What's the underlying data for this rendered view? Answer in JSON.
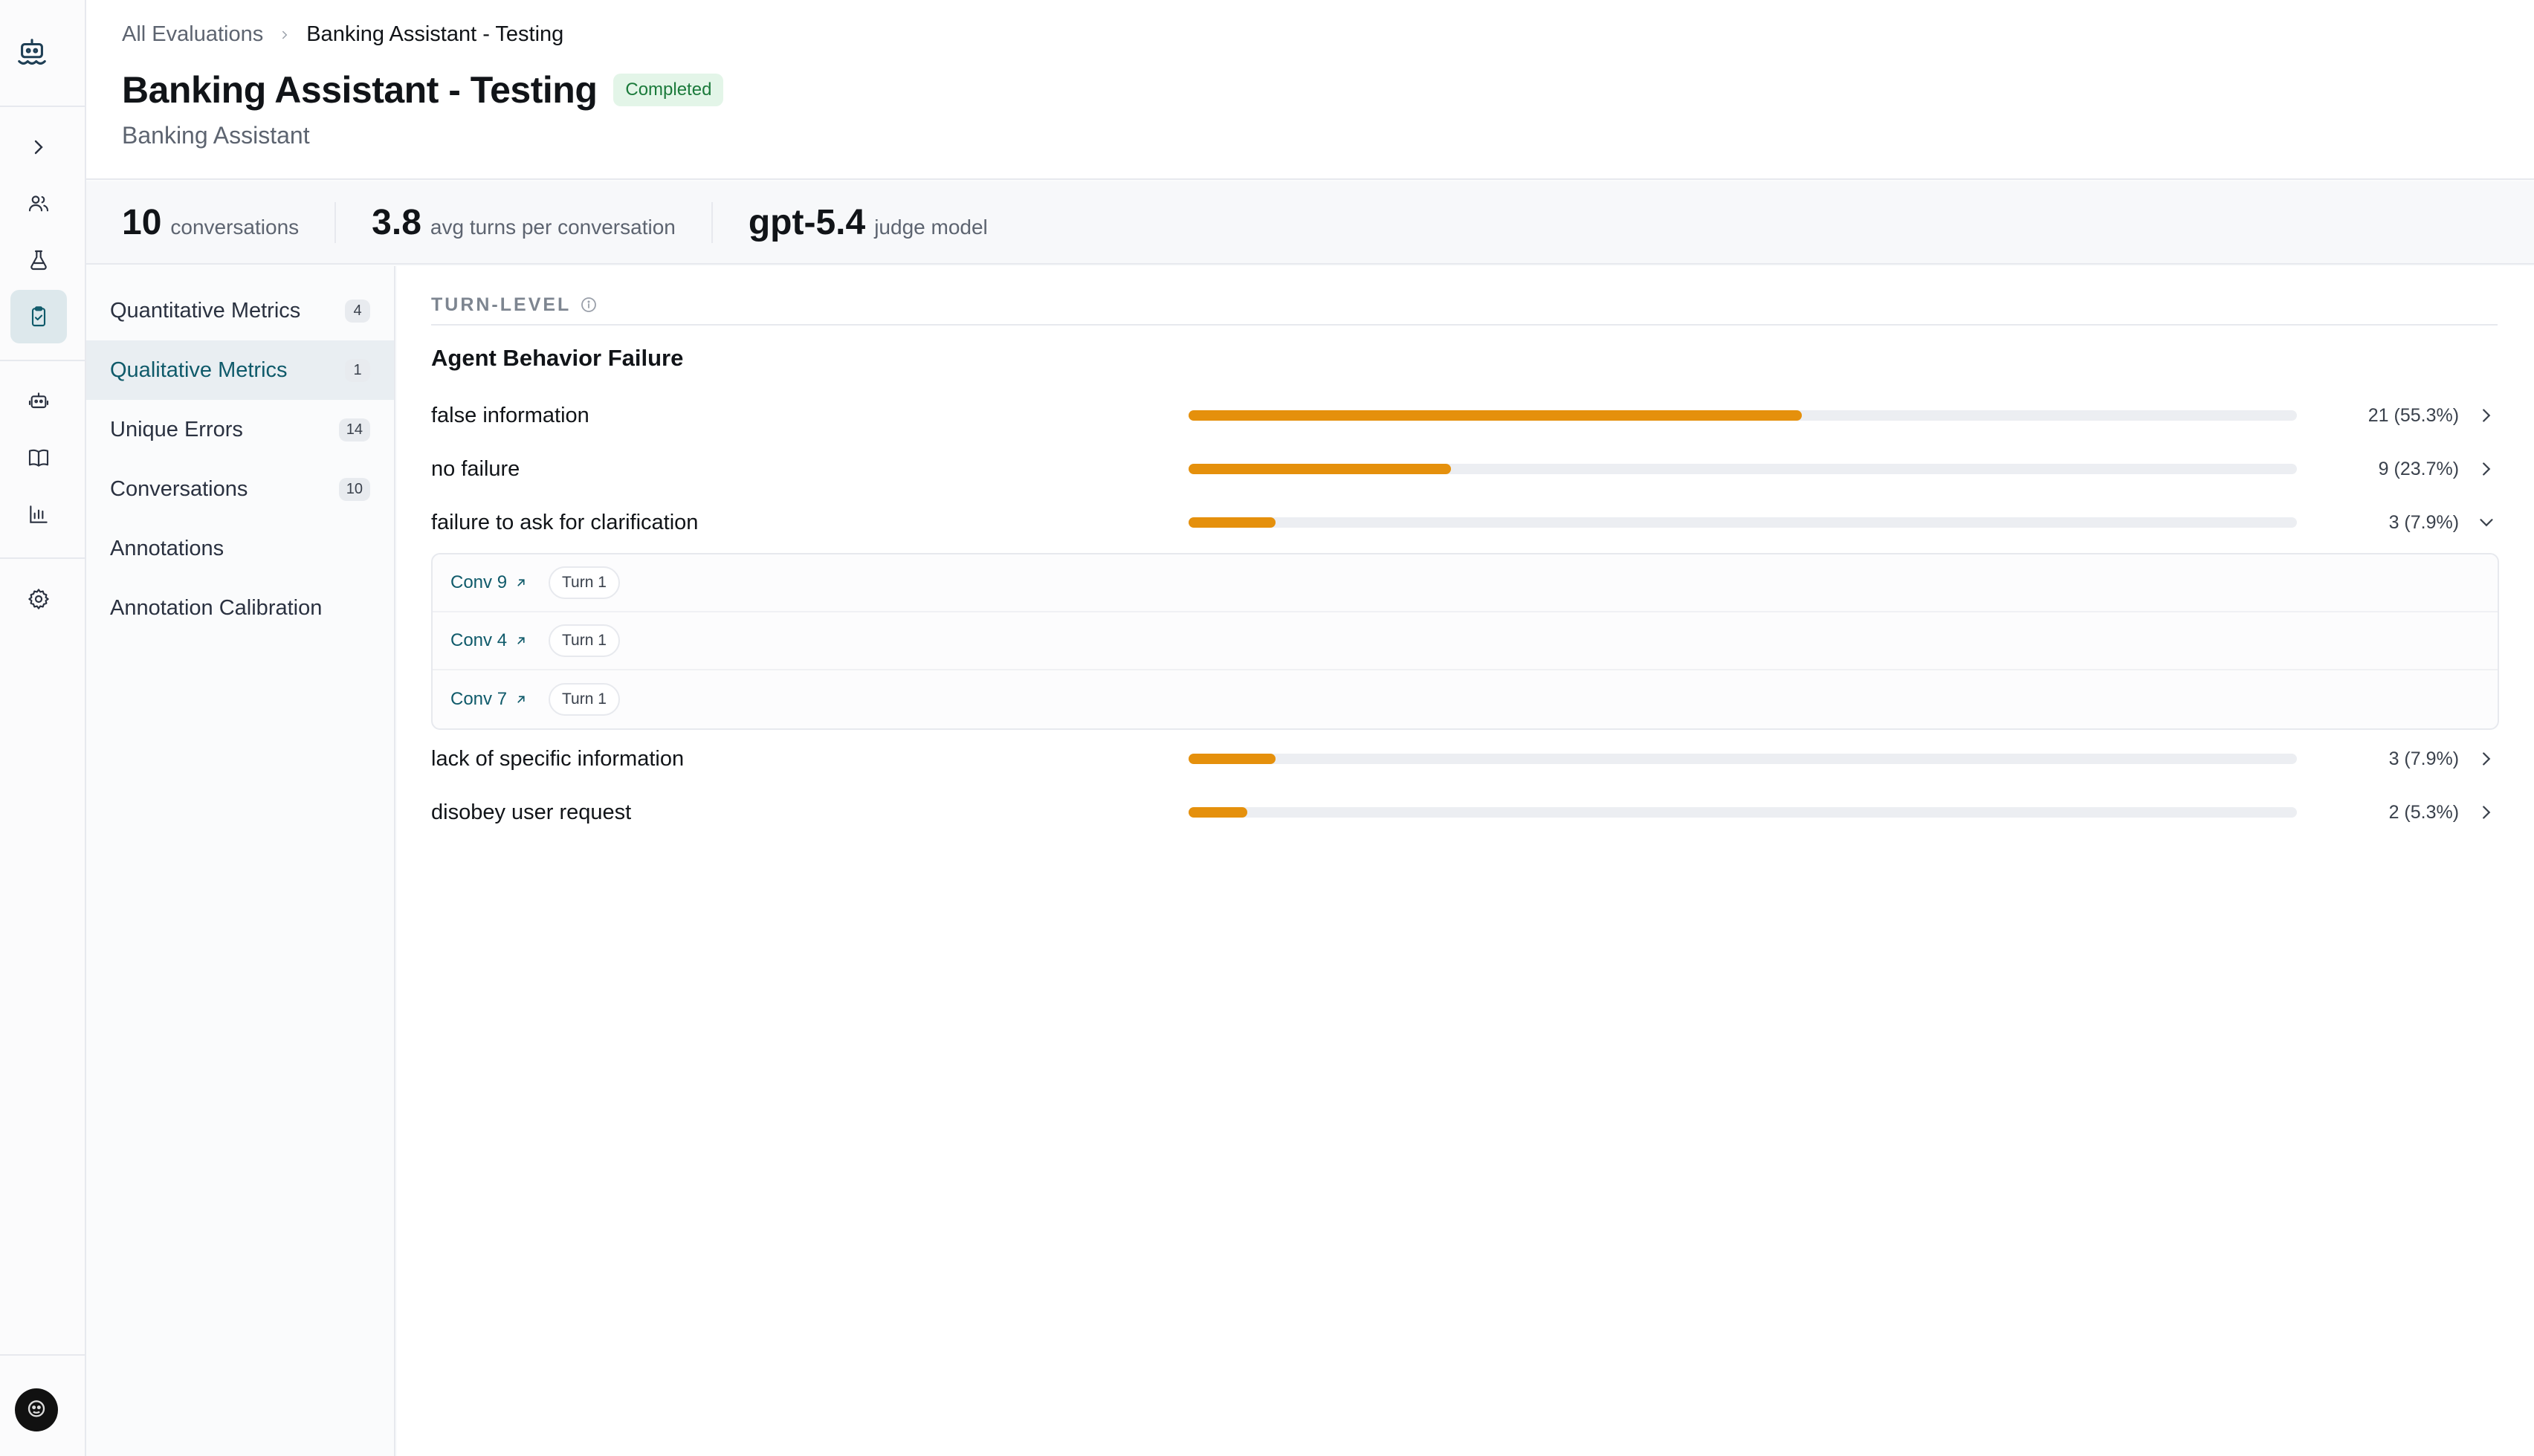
{
  "rail": {
    "items": [
      "chevron-right-icon",
      "users-icon",
      "flask-icon",
      "clipboard-check-icon",
      "robot-icon",
      "book-icon",
      "bar-chart-icon",
      "gear-icon"
    ],
    "active": "clipboard-check-icon"
  },
  "breadcrumb": {
    "root": "All Evaluations",
    "current": "Banking Assistant - Testing"
  },
  "header": {
    "title": "Banking Assistant - Testing",
    "status": "Completed",
    "subtitle": "Banking Assistant"
  },
  "stats": [
    {
      "value": "10",
      "label": "conversations"
    },
    {
      "value": "3.8",
      "label": "avg turns per conversation"
    },
    {
      "value": "gpt-5.4",
      "label": "judge model"
    }
  ],
  "nav": {
    "items": [
      {
        "label": "Quantitative Metrics",
        "count": "4"
      },
      {
        "label": "Qualitative Metrics",
        "count": "1"
      },
      {
        "label": "Unique Errors",
        "count": "14"
      },
      {
        "label": "Conversations",
        "count": "10"
      },
      {
        "label": "Annotations",
        "count": ""
      },
      {
        "label": "Annotation Calibration",
        "count": ""
      }
    ],
    "active_index": 1
  },
  "section": {
    "label": "TURN-LEVEL",
    "group_title": "Agent Behavior Failure"
  },
  "metrics": [
    {
      "name": "false information",
      "value_text": "21 (55.3%)",
      "fraction": 0.553,
      "expanded": false
    },
    {
      "name": "no failure",
      "value_text": "9 (23.7%)",
      "fraction": 0.237,
      "expanded": false
    },
    {
      "name": "failure to ask for clarification",
      "value_text": "3 (7.9%)",
      "fraction": 0.079,
      "expanded": true
    },
    {
      "name": "lack of specific information",
      "value_text": "3 (7.9%)",
      "fraction": 0.079,
      "expanded": false
    },
    {
      "name": "disobey user request",
      "value_text": "2 (5.3%)",
      "fraction": 0.053,
      "expanded": false
    }
  ],
  "expanded_rows": [
    {
      "conv": "Conv 9",
      "turn": "Turn 1"
    },
    {
      "conv": "Conv 4",
      "turn": "Turn 1"
    },
    {
      "conv": "Conv 7",
      "turn": "Turn 1"
    }
  ],
  "colors": {
    "accent": "#0f5a6a",
    "bar": "#e5900c",
    "badge_bg": "#e3f5e8",
    "badge_text": "#1b7a3b"
  }
}
